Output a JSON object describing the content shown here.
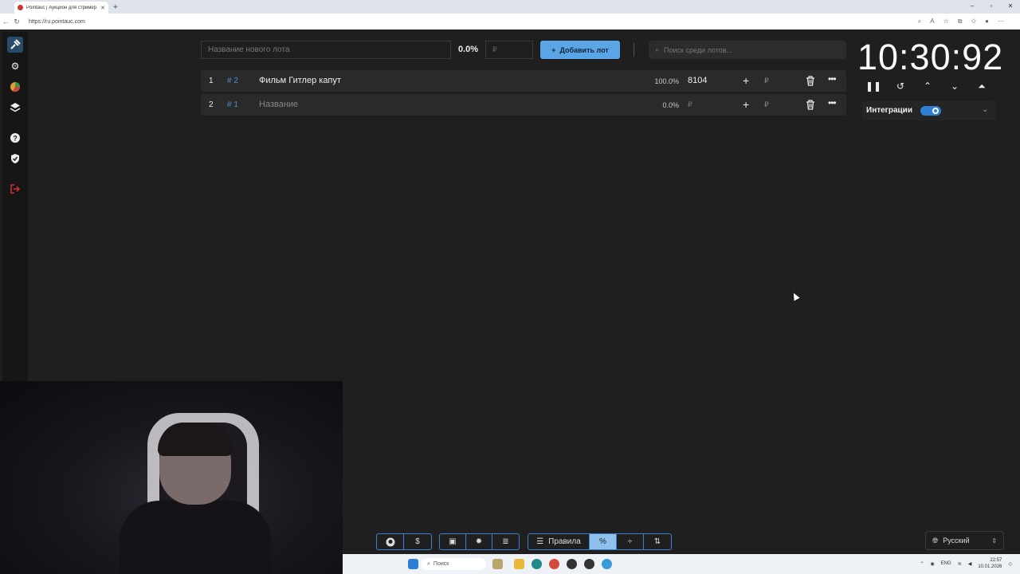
{
  "browser": {
    "tab_title": "Pointauc | Аукцион для стример",
    "url": "https://ru.pointauc.com"
  },
  "toolbar": {
    "lot_name_placeholder": "Название нового лота",
    "percent": "0.0%",
    "amount_placeholder": "₽",
    "add_lot_label": "Добавить лот",
    "search_placeholder": "Поиск среди лотов..."
  },
  "lots": [
    {
      "index": "1",
      "id": "# 2",
      "name": "Фильм Гитлер капут",
      "percent": "100.0%",
      "amount": "8104",
      "currency": "₽"
    },
    {
      "index": "2",
      "id": "# 1",
      "name": "Название",
      "percent": "0.0%",
      "amount": "₽",
      "currency": "₽"
    }
  ],
  "timer": {
    "value": "10:30:92"
  },
  "integrations": {
    "label": "Интеграции",
    "enabled": true
  },
  "bottom_bar": {
    "rules_label": "Правила"
  },
  "language": {
    "selected": "Русский"
  },
  "taskbar": {
    "search_label": "Поиск",
    "lang": "ENG",
    "time": "22:57",
    "date": "10.01.2026"
  },
  "colors": {
    "accent": "#5aa5e6",
    "link": "#4a8fd4",
    "toggle": "#2f7fd6"
  }
}
